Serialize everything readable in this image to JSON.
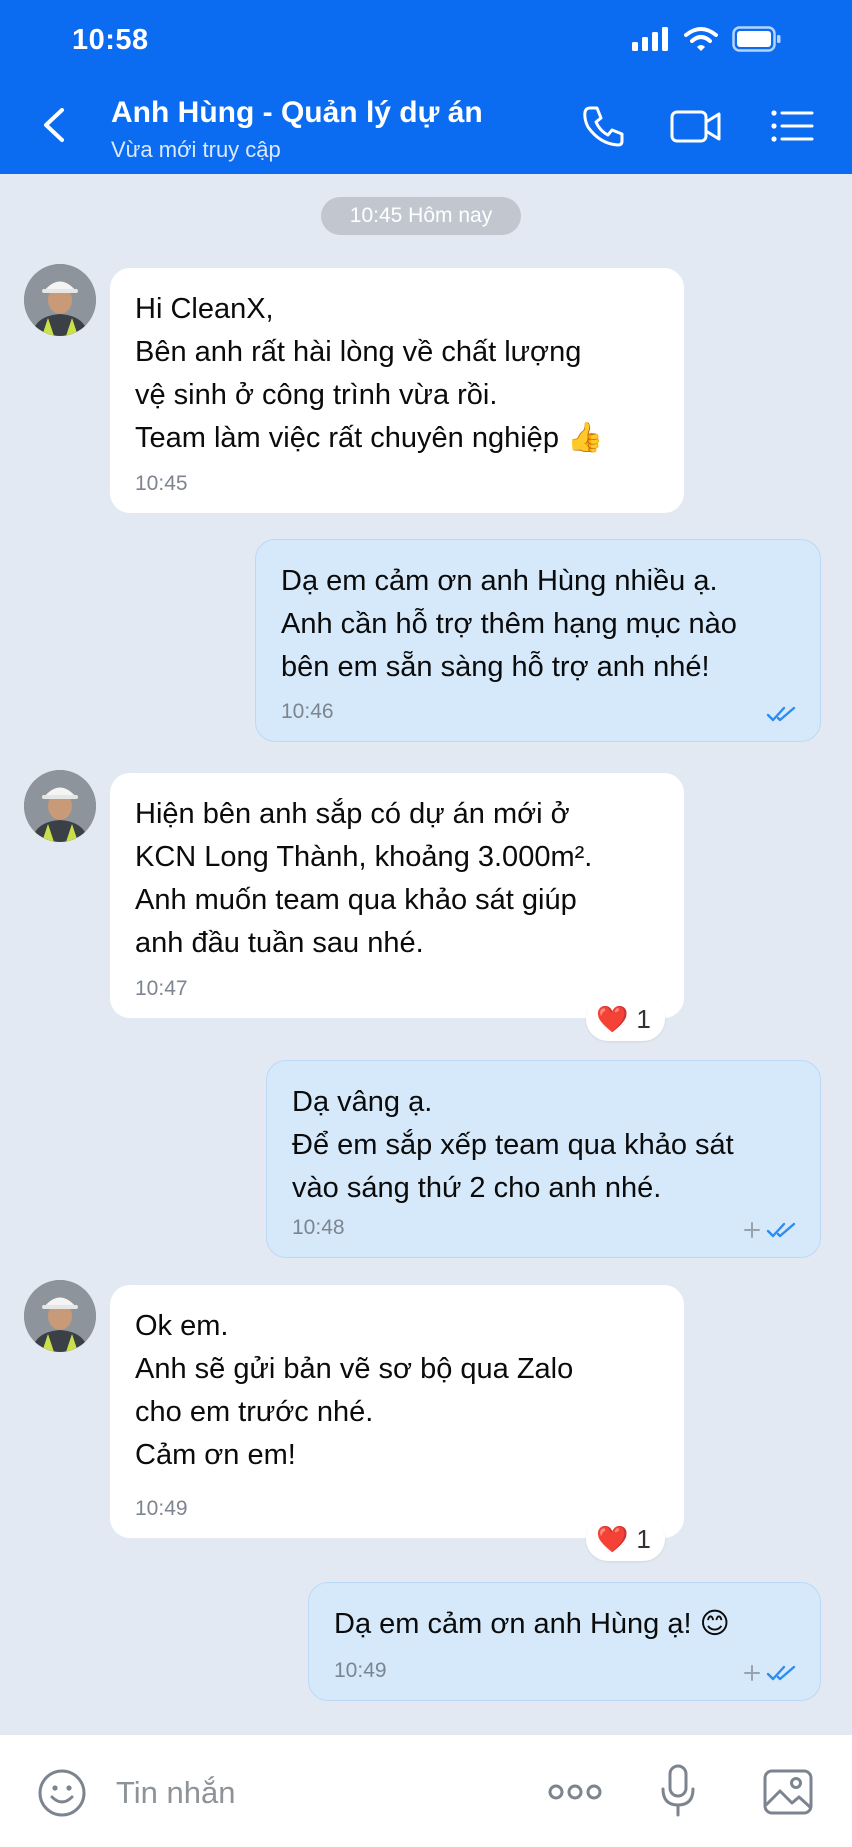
{
  "status_bar": {
    "time": "10:58"
  },
  "header": {
    "title": "Anh Hùng - Quản lý dự án",
    "subtitle": "Vừa mới truy cập",
    "icons": [
      "back-icon",
      "phone-icon",
      "video-call-icon",
      "list-menu-icon"
    ]
  },
  "date_separator": "10:45 Hôm nay",
  "messages": [
    {
      "side": "in",
      "text": "Hi CleanX,\nBên anh rất hài lòng về chất lượng\nvệ sinh ở công trình vừa rồi.\nTeam làm việc rất chuyên nghiệp 👍",
      "time": "10:45"
    },
    {
      "side": "out",
      "text": "Dạ em cảm ơn anh Hùng nhiều ạ.\nAnh cần hỗ trợ thêm hạng mục nào\nbên em sẵn sàng hỗ trợ anh nhé!",
      "time": "10:46"
    },
    {
      "side": "in",
      "text": "Hiện bên anh sắp có dự án mới ở\nKCN Long Thành, khoảng 3.000m².\nAnh muốn team qua khảo sát giúp\nanh đầu tuần sau nhé.",
      "time": "10:47",
      "reaction": {
        "emoji": "❤️",
        "count": "1"
      }
    },
    {
      "side": "out",
      "text": "Dạ vâng ạ.\nĐể em sắp xếp team qua khảo sát\nvào sáng thứ 2 cho anh nhé.",
      "time": "10:48"
    },
    {
      "side": "in",
      "text": "Ok em.\nAnh sẽ gửi bản vẽ sơ bộ qua Zalo\ncho em trước nhé.\nCảm ơn em!",
      "time": "10:49",
      "reaction": {
        "emoji": "❤️",
        "count": "1"
      }
    },
    {
      "side": "out",
      "text": "Dạ em cảm ơn anh Hùng ạ! 😊",
      "time": "10:49"
    }
  ],
  "input": {
    "placeholder": "Tin nhắn"
  },
  "colors": {
    "header": "#0b6cf2",
    "background": "#e3e9f2",
    "outgoing_bubble": "#d5e9fb",
    "incoming_bubble": "#ffffff",
    "read_tick": "#2d8cf0"
  }
}
